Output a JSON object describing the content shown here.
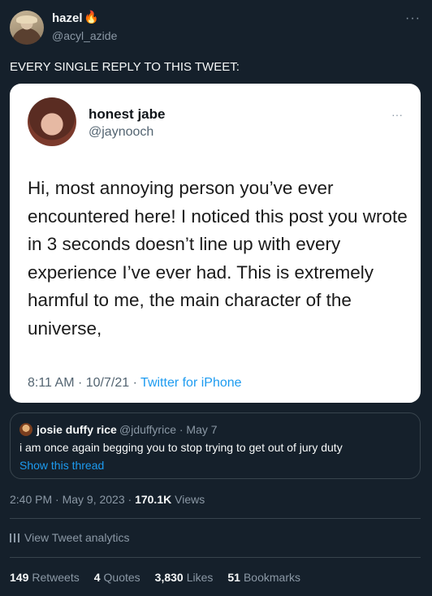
{
  "author": {
    "name": "hazel",
    "badge": "🔥",
    "handle": "@acyl_azide",
    "more": "···"
  },
  "tweet_text": "EVERY SINGLE REPLY TO THIS TWEET:",
  "image": {
    "name": "honest jabe",
    "handle": "@jaynooch",
    "more": "···",
    "body": "Hi, most annoying person you’ve ever encountered here! I noticed this post you wrote in 3 seconds doesn’t line up with every experience I’ve ever had. This is extremely harmful to me, the main character of the universe,",
    "meta_time": "8:11 AM · 10/7/21 · ",
    "meta_source": "Twitter for iPhone"
  },
  "quote": {
    "name": "josie duffy rice",
    "handle": "@jduffyrice · May 7",
    "text": "i am once again begging you to stop trying to get out of jury duty",
    "show_thread": "Show this thread"
  },
  "timestamp": {
    "time": "2:40 PM · May 9, 2023 · ",
    "views_count": "170.1K",
    "views_label": " Views"
  },
  "analytics": "View Tweet analytics",
  "stats": {
    "retweets_count": "149",
    "retweets_label": "Retweets",
    "quotes_count": "4",
    "quotes_label": "Quotes",
    "likes_count": "3,830",
    "likes_label": "Likes",
    "bookmarks_count": "51",
    "bookmarks_label": "Bookmarks"
  },
  "colors": {
    "background": "#15202b",
    "accent": "#1d9bf0",
    "muted": "#8b98a5",
    "border": "#38444d"
  }
}
